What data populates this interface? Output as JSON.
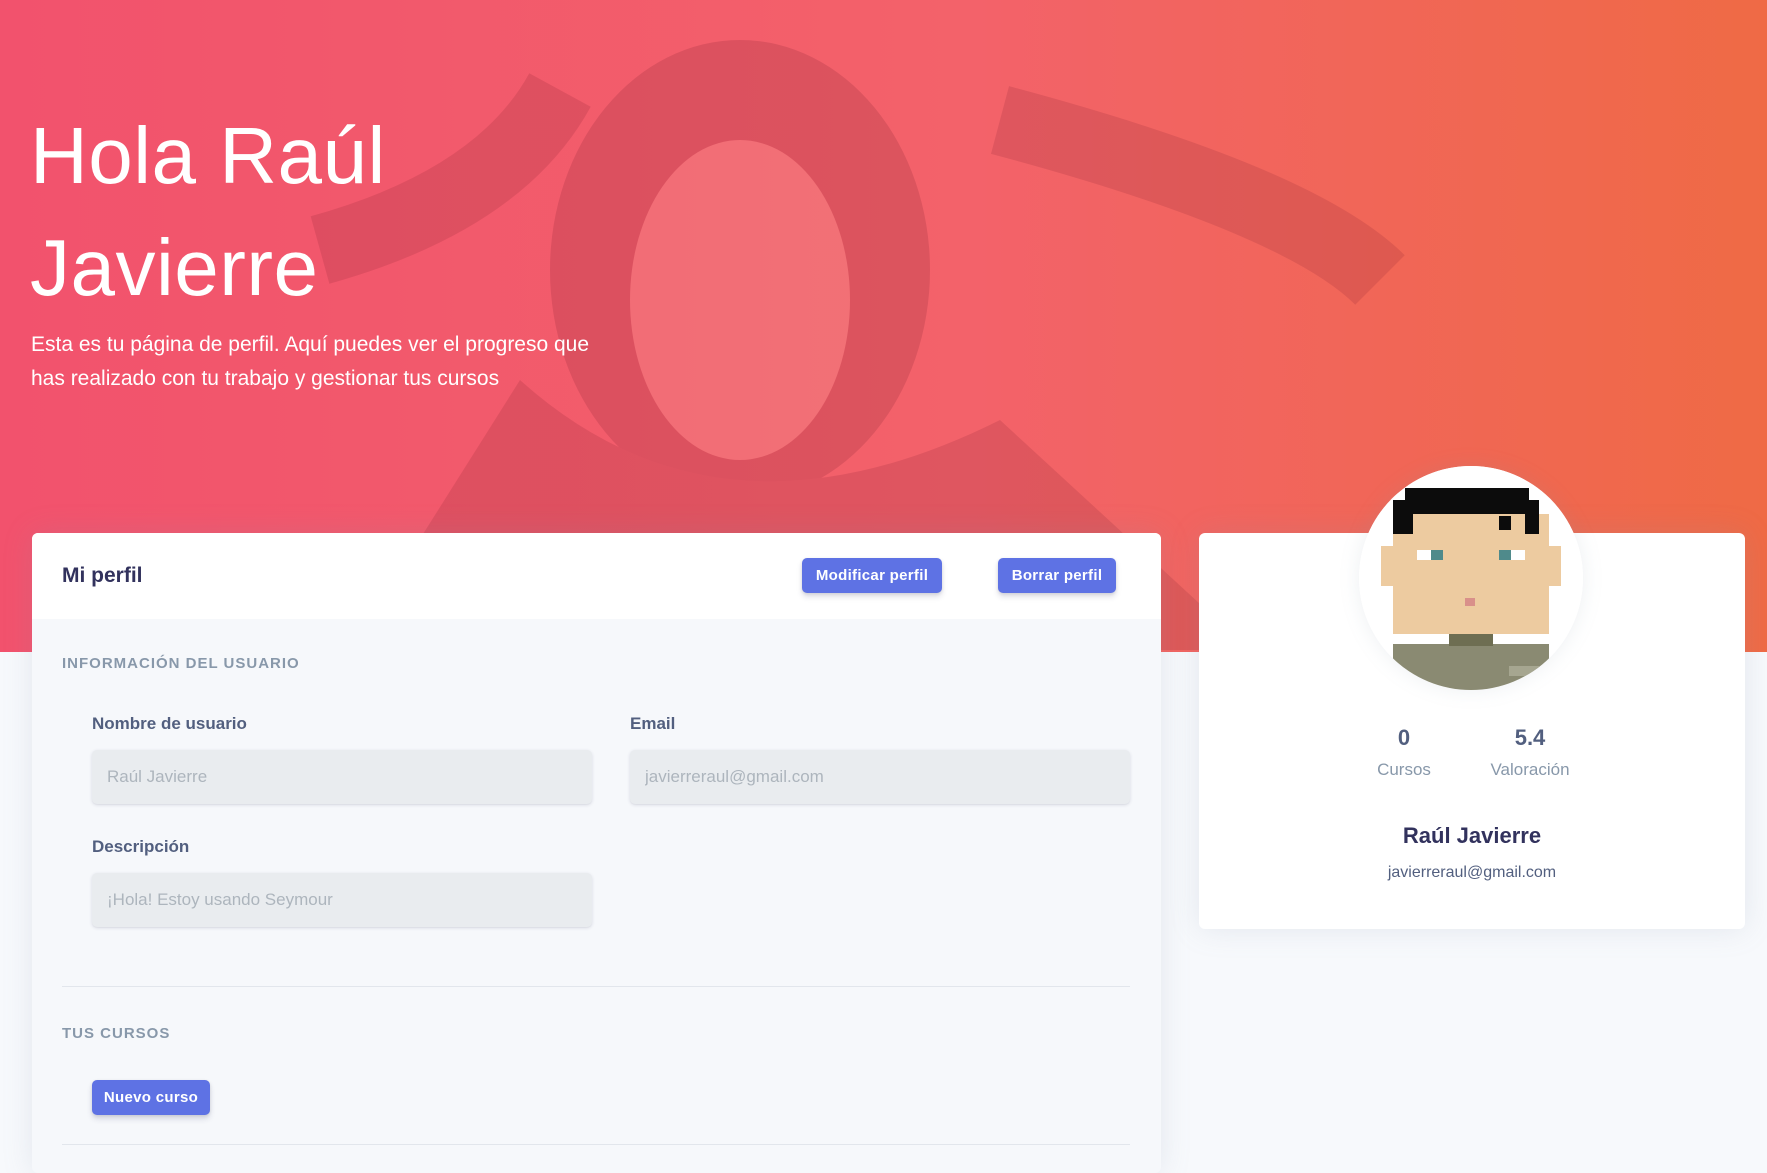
{
  "hero": {
    "title": "Hola Raúl Javierre",
    "subtitle": "Esta es tu página de perfil. Aquí puedes ver el progreso que has realizado con tu trabajo y gestionar tus cursos"
  },
  "profile_card": {
    "title": "Mi perfil",
    "modify_button": "Modificar perfil",
    "delete_button": "Borrar perfil",
    "user_info_heading": "Información del usuario",
    "username_label": "Nombre de usuario",
    "username_placeholder": "Raúl Javierre",
    "email_label": "Email",
    "email_placeholder": "javierreraul@gmail.com",
    "description_label": "Descripción",
    "description_placeholder": "¡Hola! Estoy usando Seymour",
    "courses_heading": "Tus cursos",
    "new_course_button": "Nuevo curso"
  },
  "side_card": {
    "courses_value": "0",
    "courses_label": "Cursos",
    "rating_value": "5.4",
    "rating_label": "Valoración",
    "name": "Raúl Javierre",
    "email": "javierreraul@gmail.com"
  },
  "colors": {
    "primary": "#5e72e4",
    "hero_start": "#f2526d",
    "hero_end": "#ef6a45"
  }
}
